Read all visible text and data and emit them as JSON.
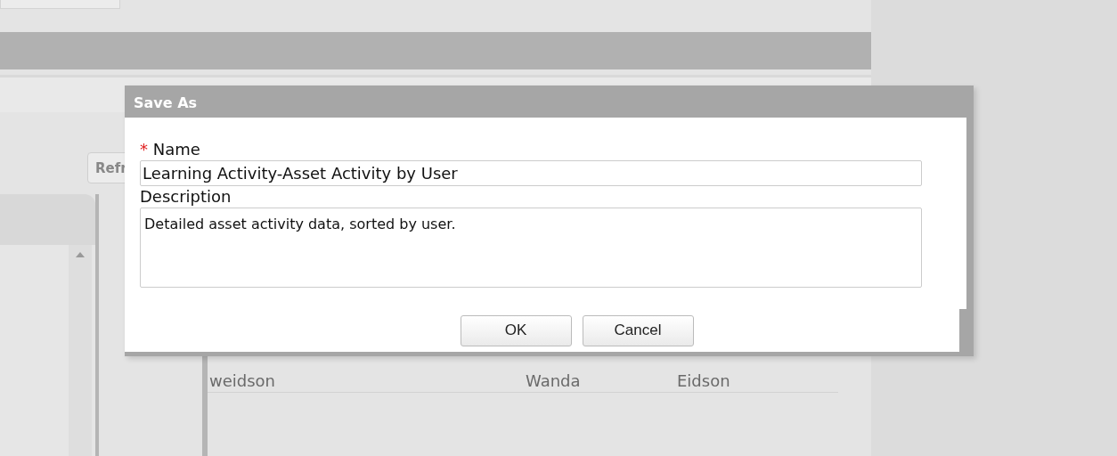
{
  "background": {
    "refresh_button": "Refr",
    "table": {
      "rows": [
        [
          "weidson",
          "Wanda",
          "Eidson"
        ]
      ]
    }
  },
  "dialog": {
    "title": "Save As",
    "required_mark": "*",
    "fields": [
      {
        "label": "Name",
        "required": true,
        "kind": "text",
        "value": "Learning Activity-Asset Activity by User"
      },
      {
        "label": "Description",
        "required": false,
        "kind": "textarea",
        "value": "Detailed asset activity data, sorted by user."
      }
    ],
    "buttons": [
      "OK",
      "Cancel"
    ]
  }
}
